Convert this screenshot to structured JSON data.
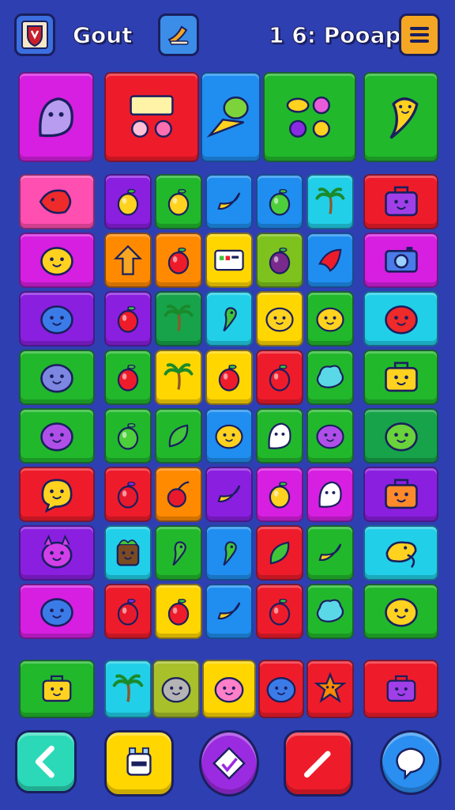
{
  "header": {
    "player_name": "Gout",
    "score_text": "1 6: Pooap",
    "colors": {
      "background": "#2e3fb2",
      "menu_button": "#f5a623",
      "quest_button": "#3b8de8"
    }
  },
  "board": {
    "palette": {
      "magenta": "#d61fe0",
      "red": "#ee1c2b",
      "blue": "#1f8ef0",
      "green": "#22b82c",
      "purple": "#8a1fe0",
      "cyan": "#22cfe8",
      "yellow": "#ffd600",
      "orange": "#ff8a00",
      "lime": "#7ec21d",
      "pink": "#ff4fb0",
      "darkgreen": "#17a34a",
      "olive": "#a8c02a"
    },
    "top_row": [
      {
        "color": "magenta",
        "icon": "ghost-blob-icon"
      },
      {
        "color": "red",
        "icon": "sign-monsters-icon"
      },
      {
        "color": "blue",
        "icon": "fruit-and-plane-icon"
      },
      {
        "color": "green",
        "icon": "fruit-bundle-icon"
      },
      {
        "color": "green",
        "icon": "banana-creature-icon"
      }
    ],
    "left_column": [
      {
        "color": "pink",
        "icon": "lemon-creature-icon"
      },
      {
        "color": "magenta",
        "icon": "yellow-blob-icon"
      },
      {
        "color": "purple",
        "icon": "blue-blob-icon"
      },
      {
        "color": "green",
        "icon": "grumpy-blob-icon"
      },
      {
        "color": "green",
        "icon": "purple-blob-icon"
      },
      {
        "color": "red",
        "icon": "speech-blob-icon"
      },
      {
        "color": "purple",
        "icon": "purple-monster-icon"
      },
      {
        "color": "magenta",
        "icon": "blue-blob-icon"
      }
    ],
    "right_column": [
      {
        "color": "red",
        "icon": "purple-suitcase-icon"
      },
      {
        "color": "magenta",
        "icon": "camera-icon"
      },
      {
        "color": "cyan",
        "icon": "red-blob-icon"
      },
      {
        "color": "green",
        "icon": "yellow-suitcase-icon"
      },
      {
        "color": "darkgreen",
        "icon": "lime-creature-icon"
      },
      {
        "color": "purple",
        "icon": "orange-suitcase-icon"
      },
      {
        "color": "cyan",
        "icon": "yellow-bird-icon"
      },
      {
        "color": "green",
        "icon": "yellow-blob-icon"
      }
    ],
    "grid": [
      [
        {
          "color": "purple",
          "icon": "lemon-icon"
        },
        {
          "color": "green",
          "icon": "lemon-icon"
        },
        {
          "color": "blue",
          "icon": "banana-icon"
        },
        {
          "color": "blue",
          "icon": "lime-icon"
        },
        {
          "color": "cyan",
          "icon": "palm-tree-icon"
        }
      ],
      [
        {
          "color": "orange",
          "icon": "up-arrow-icon"
        },
        {
          "color": "orange",
          "icon": "apple-icon"
        },
        {
          "color": "yellow",
          "icon": "sign-icon"
        },
        {
          "color": "lime",
          "icon": "plum-icon"
        },
        {
          "color": "blue",
          "icon": "red-leaf-icon"
        }
      ],
      [
        {
          "color": "purple",
          "icon": "apple-icon"
        },
        {
          "color": "darkgreen",
          "icon": "palm-tree-icon"
        },
        {
          "color": "cyan",
          "icon": "green-bird-icon"
        },
        {
          "color": "yellow",
          "icon": "face-blob-icon"
        },
        {
          "color": "green",
          "icon": "face-blob-icon"
        }
      ],
      [
        {
          "color": "green",
          "icon": "apple-icon"
        },
        {
          "color": "yellow",
          "icon": "palm-tree-icon"
        },
        {
          "color": "yellow",
          "icon": "apple-icon"
        },
        {
          "color": "red",
          "icon": "apple-icon"
        },
        {
          "color": "green",
          "icon": "cyan-cloud-icon"
        }
      ],
      [
        {
          "color": "green",
          "icon": "lime-icon"
        },
        {
          "color": "green",
          "icon": "leaf-icon"
        },
        {
          "color": "blue",
          "icon": "yellow-blob-icon"
        },
        {
          "color": "green",
          "icon": "ghost-icon"
        },
        {
          "color": "green",
          "icon": "purple-blob-icon"
        }
      ],
      [
        {
          "color": "red",
          "icon": "strawberry-icon"
        },
        {
          "color": "orange",
          "icon": "cherry-icon"
        },
        {
          "color": "purple",
          "icon": "banana-icon"
        },
        {
          "color": "magenta",
          "icon": "lemon-icon"
        },
        {
          "color": "magenta",
          "icon": "ghost-icon"
        }
      ],
      [
        {
          "color": "cyan",
          "icon": "stump-creature-icon"
        },
        {
          "color": "green",
          "icon": "green-bird-icon"
        },
        {
          "color": "blue",
          "icon": "green-bird-icon"
        },
        {
          "color": "red",
          "icon": "leaf-icon"
        },
        {
          "color": "green",
          "icon": "banana-icon"
        }
      ],
      [
        {
          "color": "red",
          "icon": "strawberry-icon"
        },
        {
          "color": "yellow",
          "icon": "apple-icon"
        },
        {
          "color": "blue",
          "icon": "banana-icon"
        },
        {
          "color": "red",
          "icon": "apple-icon"
        },
        {
          "color": "green",
          "icon": "cyan-cloud-icon"
        }
      ]
    ],
    "bottom_row": [
      {
        "color": "green",
        "icon": "yellow-suitcase-icon"
      },
      {
        "color": "cyan",
        "icon": "palm-tree-icon"
      },
      {
        "color": "olive",
        "icon": "grey-blob-icon"
      },
      {
        "color": "yellow",
        "icon": "pink-blob-icon"
      },
      {
        "color": "red",
        "icon": "blue-blob-icon"
      },
      {
        "color": "red",
        "icon": "star-creature-icon"
      },
      {
        "color": "red",
        "icon": "purple-suitcase-icon"
      }
    ]
  },
  "toolbar": [
    {
      "name": "back-button",
      "icon": "chevron-left-icon",
      "color": "#2bd9b8"
    },
    {
      "name": "robot-button",
      "icon": "robot-icon",
      "color": "#ffd600"
    },
    {
      "name": "gem-button",
      "icon": "gem-icon",
      "color": "#9b2be0"
    },
    {
      "name": "pencil-button",
      "icon": "pencil-icon",
      "color": "#ee1c2b"
    },
    {
      "name": "chat-button",
      "icon": "chat-bubble-icon",
      "color": "#2a8ff0"
    }
  ]
}
